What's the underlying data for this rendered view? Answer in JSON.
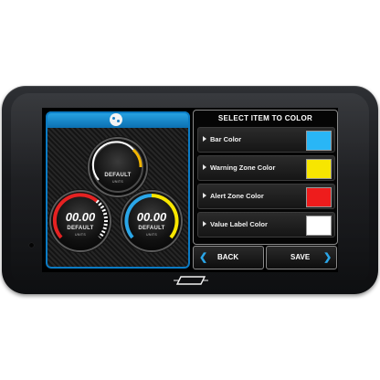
{
  "screen": {
    "heading": "SELECT ITEM TO COLOR",
    "rows": [
      {
        "label": "Bar Color",
        "swatch": "#29b6f6"
      },
      {
        "label": "Warning Zone Color",
        "swatch": "#f7e600"
      },
      {
        "label": "Alert Zone Color",
        "swatch": "#ee1c1c"
      },
      {
        "label": "Value Label Color",
        "swatch": "#ffffff"
      }
    ],
    "back_label": "BACK",
    "save_label": "SAVE",
    "accent": "#1a8fd6"
  },
  "gauges": {
    "top": {
      "label": "DEFAULT",
      "unit": "UNITS",
      "ring": "#ffffff",
      "band": "#f0b400"
    },
    "left": {
      "value": "00.00",
      "label": "DEFAULT",
      "unit": "UNITS",
      "ring": "#e52222",
      "band": "#ffffff"
    },
    "right": {
      "value": "00.00",
      "label": "DEFAULT",
      "unit": "UNITS",
      "ring": "#2aa6e8",
      "band": "#f7e600"
    }
  },
  "icons": {
    "title": "palette-icon",
    "row_arrow": "caret-right-icon",
    "back": "chevron-left-icon",
    "save": "chevron-right-icon"
  }
}
